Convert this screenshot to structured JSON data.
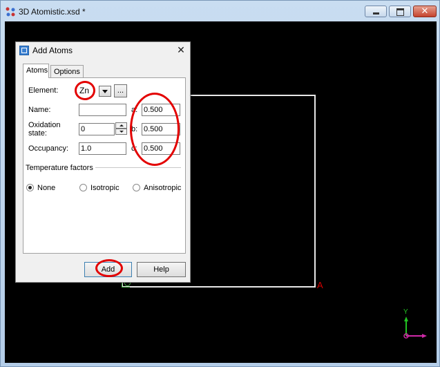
{
  "window": {
    "title": "3D Atomistic.xsd *",
    "close_glyph": "✕"
  },
  "viewport": {
    "axis_a_label": "A",
    "axis_y_label": "Y"
  },
  "dialog": {
    "title": "Add Atoms",
    "close_glyph": "✕",
    "tabs": [
      {
        "label": "Atoms",
        "selected": true
      },
      {
        "label": "Options",
        "selected": false
      }
    ],
    "element": {
      "label": "Element:",
      "value": "Zn",
      "browse_label": "..."
    },
    "name": {
      "label": "Name:",
      "value": ""
    },
    "oxidation": {
      "label_line1": "Oxidation",
      "label_line2": "state:",
      "value": "0"
    },
    "occupancy": {
      "label": "Occupancy:",
      "value": "1.0"
    },
    "coords": [
      {
        "label": "a:",
        "value": "0.500"
      },
      {
        "label": "b:",
        "value": "0.500"
      },
      {
        "label": "c:",
        "value": "0.500"
      }
    ],
    "temperature": {
      "group_label": "Temperature factors",
      "options": [
        {
          "label": "None",
          "selected": true
        },
        {
          "label": "Isotropic",
          "selected": false
        },
        {
          "label": "Anisotropic",
          "selected": false
        }
      ]
    },
    "buttons": {
      "add": "Add",
      "help": "Help"
    }
  },
  "colors": {
    "annotation": "#e30000",
    "canvas": "#000000",
    "unit_cell": "#e8e8e8",
    "axis_a": "#d40000",
    "axis_y": "#22c222"
  }
}
